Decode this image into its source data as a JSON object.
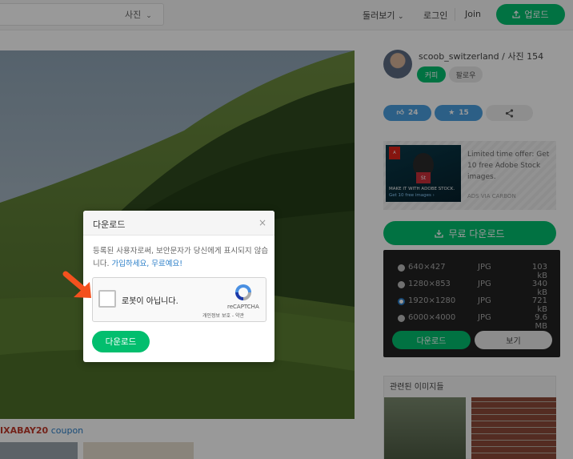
{
  "header": {
    "search_type": "사진",
    "browse": "둘러보기",
    "login": "로그인",
    "join": "Join",
    "upload": "업로드"
  },
  "coupon": {
    "code": "IXABAY20",
    "text": "coupon"
  },
  "author": {
    "line": "scoob_switzerland / 사진 154",
    "coffee": "커피",
    "follow": "팔로우"
  },
  "stats": {
    "likes": "24",
    "favorites": "15"
  },
  "ad": {
    "text": "Limited time offer: Get 10 free Adobe Stock images.",
    "via": "ADS VIA CARBON",
    "image_caption": "MAKE IT WITH ADOBE STOCK.",
    "image_sub": "Get 10 free images ›",
    "logo": "Adobe"
  },
  "download": {
    "main_label": "무료 다운로드",
    "options": [
      {
        "dim": "640×427",
        "fmt": "JPG",
        "size": "103 kB",
        "selected": false
      },
      {
        "dim": "1280×853",
        "fmt": "JPG",
        "size": "340 kB",
        "selected": false
      },
      {
        "dim": "1920×1280",
        "fmt": "JPG",
        "size": "721 kB",
        "selected": true
      },
      {
        "dim": "6000×4000",
        "fmt": "JPG",
        "size": "9.6 MB",
        "selected": false
      }
    ],
    "download_btn": "다운로드",
    "view_btn": "보기"
  },
  "related": {
    "title": "관련된 이미지들"
  },
  "modal": {
    "title": "다운로드",
    "close": "×",
    "body": "등록된 사용자로써, 보안문자가 당신에게 표시되지 않습니다.",
    "link_signup": "가입하세요, 무료예요!",
    "captcha_label": "로봇이 아닙니다.",
    "captcha_brand": "reCAPTCHA",
    "captcha_links": "개인정보 보호 - 약관",
    "download_btn": "다운로드"
  },
  "colors": {
    "accent": "#02be6e",
    "link": "#2a7ec8",
    "arrow": "#f4511e"
  }
}
